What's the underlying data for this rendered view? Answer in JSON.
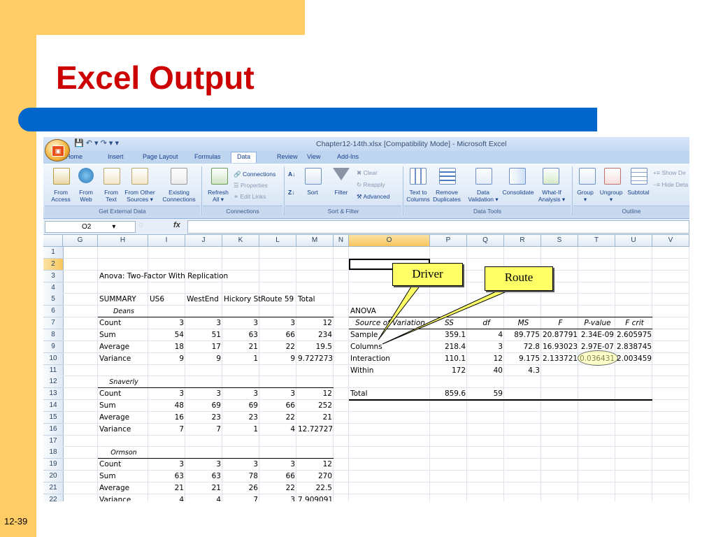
{
  "slide": {
    "title": "Excel Output",
    "number": "12-39"
  },
  "excel": {
    "window_title": "Chapter12-14th.xlsx  [Compatibility Mode] - Microsoft Excel",
    "tabs": [
      "Home",
      "Insert",
      "Page Layout",
      "Formulas",
      "Data",
      "Review",
      "View",
      "Add-Ins"
    ],
    "active_tab": "Data",
    "ribbon": {
      "get_external": {
        "from_access": "From\nAccess",
        "from_web": "From\nWeb",
        "from_text": "From\nText",
        "from_other": "From Other\nSources ▾",
        "existing": "Existing\nConnections",
        "group": "Get External Data"
      },
      "connections": {
        "refresh": "Refresh\nAll ▾",
        "connections": "Connections",
        "properties": "Properties",
        "edit_links": "Edit Links",
        "group": "Connections"
      },
      "sort_filter": {
        "sort": "Sort",
        "filter": "Filter",
        "clear": "Clear",
        "reapply": "Reapply",
        "advanced": "Advanced",
        "group": "Sort & Filter"
      },
      "data_tools": {
        "text_to_columns": "Text to\nColumns",
        "remove_duplicates": "Remove\nDuplicates",
        "data_validation": "Data\nValidation ▾",
        "consolidate": "Consolidate",
        "what_if": "What-If\nAnalysis ▾",
        "group": "Data Tools"
      },
      "outline": {
        "group_btn": "Group\n▾",
        "ungroup": "Ungroup\n▾",
        "subtotal": "Subtotal",
        "show_detail": "Show De",
        "hide_detail": "Hide Deta",
        "group": "Outline"
      }
    },
    "name_box": "O2",
    "fx": "fx",
    "columns": [
      "G",
      "H",
      "I",
      "J",
      "K",
      "L",
      "M",
      "N",
      "O",
      "P",
      "Q",
      "R",
      "S",
      "T",
      "U",
      "V"
    ],
    "rows": [
      "1",
      "2",
      "3",
      "4",
      "5",
      "6",
      "7",
      "8",
      "9",
      "10",
      "11",
      "12",
      "13",
      "14",
      "15",
      "16",
      "17",
      "18",
      "19",
      "20",
      "21",
      "22"
    ],
    "cells": {
      "h3": "Anova: Two-Factor With Replication",
      "summary": [
        "SUMMARY",
        "US6",
        "WestEnd",
        "Hickory St",
        "Route 59",
        "Total"
      ],
      "groups": [
        {
          "name": "Deans",
          "rows": [
            [
              "Count",
              "3",
              "3",
              "3",
              "3",
              "12"
            ],
            [
              "Sum",
              "54",
              "51",
              "63",
              "66",
              "234"
            ],
            [
              "Average",
              "18",
              "17",
              "21",
              "22",
              "19.5"
            ],
            [
              "Variance",
              "9",
              "9",
              "1",
              "9",
              "9.727273"
            ]
          ]
        },
        {
          "name": "Snaverly",
          "rows": [
            [
              "Count",
              "3",
              "3",
              "3",
              "3",
              "12"
            ],
            [
              "Sum",
              "48",
              "69",
              "69",
              "66",
              "252"
            ],
            [
              "Average",
              "16",
              "23",
              "23",
              "22",
              "21"
            ],
            [
              "Variance",
              "7",
              "7",
              "1",
              "4",
              "12.72727"
            ]
          ]
        },
        {
          "name": "Ormson",
          "rows": [
            [
              "Count",
              "3",
              "3",
              "3",
              "3",
              "12"
            ],
            [
              "Sum",
              "63",
              "63",
              "78",
              "66",
              "270"
            ],
            [
              "Average",
              "21",
              "21",
              "26",
              "22",
              "22.5"
            ],
            [
              "Variance",
              "4",
              "4",
              "7",
              "3",
              "7.909091"
            ]
          ]
        }
      ],
      "anova_title": "ANOVA",
      "anova_headers": [
        "Source of Variation",
        "SS",
        "df",
        "MS",
        "F",
        "P-value",
        "F crit"
      ],
      "anova_rows": [
        [
          "Sample",
          "359.1",
          "4",
          "89.775",
          "20.87791",
          "2.34E-09",
          "2.605975"
        ],
        [
          "Columns",
          "218.4",
          "3",
          "72.8",
          "16.93023",
          "2.97E-07",
          "2.838745"
        ],
        [
          "Interaction",
          "110.1",
          "12",
          "9.175",
          "2.133721",
          "0.036431",
          "2.003459"
        ],
        [
          "Within",
          "172",
          "40",
          "4.3",
          "",
          "",
          ""
        ],
        [
          "",
          "",
          "",
          "",
          "",
          "",
          ""
        ],
        [
          "Total",
          "859.6",
          "59",
          "",
          "",
          "",
          ""
        ]
      ]
    },
    "callouts": {
      "driver": "Driver",
      "route": "Route"
    }
  }
}
